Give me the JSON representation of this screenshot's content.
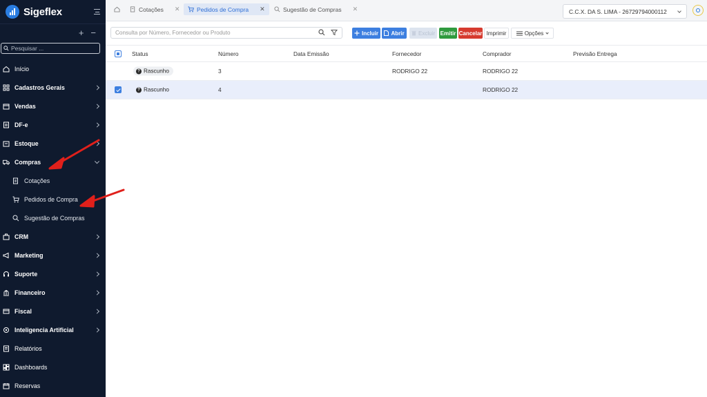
{
  "app": {
    "name": "Sigeflex"
  },
  "sidebar": {
    "search_placeholder": "Pesquisar ...",
    "items": [
      {
        "label": "Início"
      },
      {
        "label": "Cadastros Gerais"
      },
      {
        "label": "Vendas"
      },
      {
        "label": "DF-e"
      },
      {
        "label": "Estoque"
      },
      {
        "label": "Compras"
      },
      {
        "label": "Cotações"
      },
      {
        "label": "Pedidos de Compra"
      },
      {
        "label": "Sugestão de Compras"
      },
      {
        "label": "CRM"
      },
      {
        "label": "Marketing"
      },
      {
        "label": "Suporte"
      },
      {
        "label": "Financeiro"
      },
      {
        "label": "Fiscal"
      },
      {
        "label": "Inteligencia Artificial"
      },
      {
        "label": "Relatórios"
      },
      {
        "label": "Dashboards"
      },
      {
        "label": "Reservas"
      }
    ]
  },
  "tabs": [
    {
      "label": "Cotações"
    },
    {
      "label": "Pedidos de Compra"
    },
    {
      "label": "Sugestão de Compras"
    }
  ],
  "company": {
    "value": "C.C.X. DA S. LIMA - 26729794000112"
  },
  "toolbar": {
    "query_placeholder": "Consulta por Número, Fornecedor ou Produto",
    "incluir": "Incluir",
    "abrir": "Abrir",
    "excluir": "Excluir",
    "emitir": "Emitir",
    "cancelar": "Cancelar",
    "imprimir": "Imprimir",
    "opcoes": "Opções"
  },
  "grid": {
    "columns": [
      "Status",
      "Número",
      "Data Emissão",
      "Fornecedor",
      "Comprador",
      "Previsão Entrega"
    ],
    "rows": [
      {
        "status": "Rascunho",
        "numero": "3",
        "data": "",
        "fornecedor": "RODRIGO 22",
        "comprador": "RODRIGO 22",
        "previsao": "",
        "selected": false
      },
      {
        "status": "Rascunho",
        "numero": "4",
        "data": "",
        "fornecedor": "",
        "comprador": "RODRIGO 22",
        "previsao": "",
        "selected": true
      }
    ]
  },
  "colors": {
    "sidebar_bg": "#0f1a2e",
    "accent": "#3d7fe0",
    "emitir": "#2f9a3e",
    "cancelar": "#d63b2f",
    "arrow": "#e0201b"
  }
}
